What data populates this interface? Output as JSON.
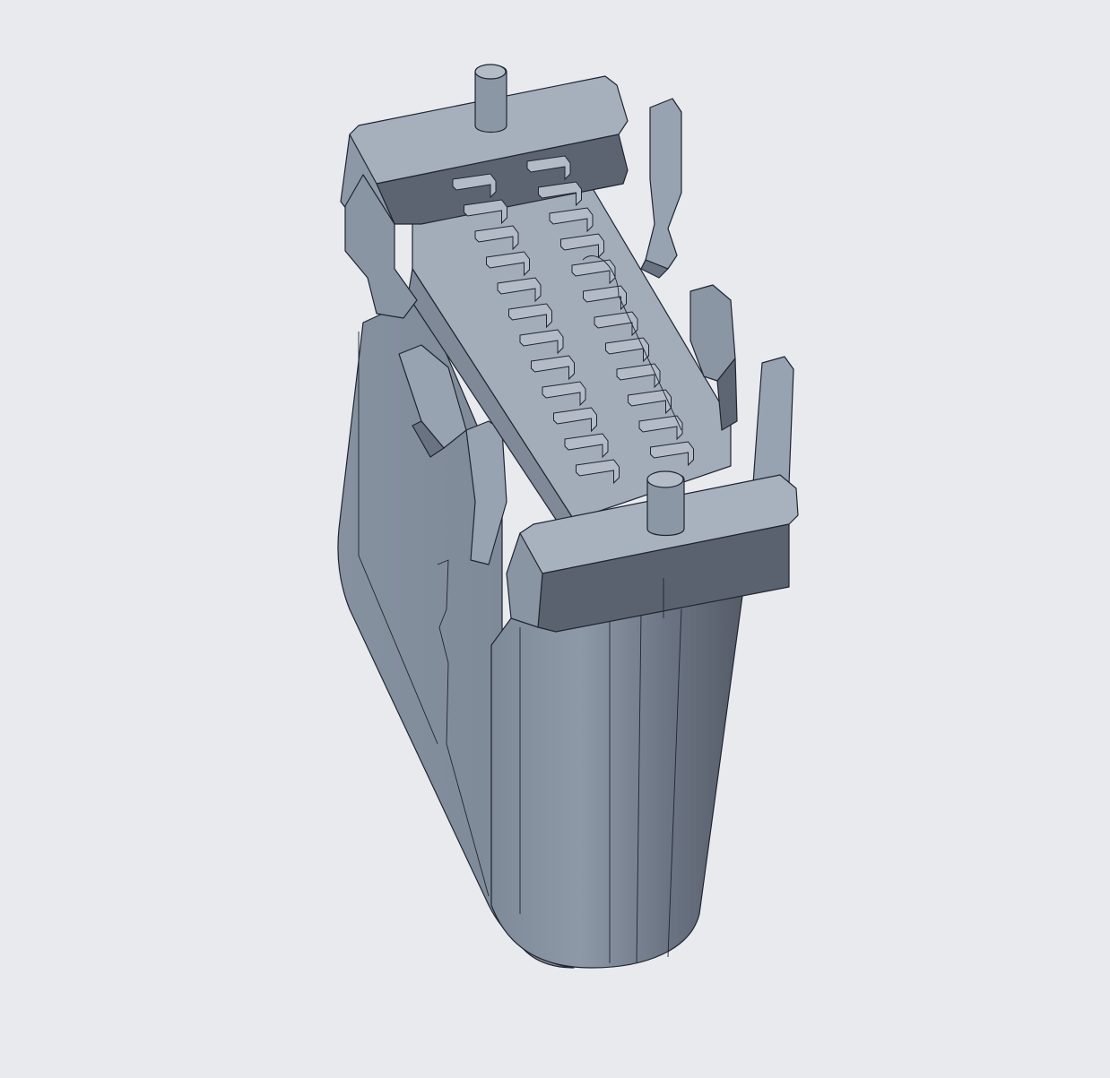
{
  "scene": {
    "subject": "usb-type-c-receptacle-connector",
    "background_color": "#e8eaee",
    "body_color": "#8a96a6",
    "top_color": "#a6b0bd",
    "dark_face_color": "#5a6270",
    "edge_color": "#1f2530",
    "pin_count_per_row": 12,
    "pin_rows": 2
  }
}
